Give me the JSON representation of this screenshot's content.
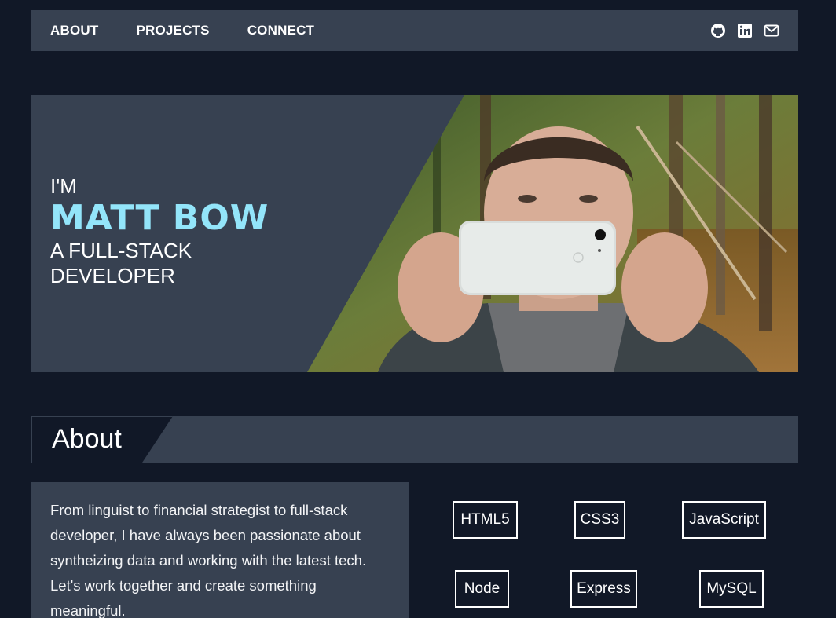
{
  "nav": {
    "links": [
      "ABOUT",
      "PROJECTS",
      "CONNECT"
    ],
    "icons": [
      "github-icon",
      "linkedin-icon",
      "mail-icon"
    ]
  },
  "hero": {
    "intro": "I'M",
    "name": "MATT BOW",
    "role_line1": "A FULL-STACK",
    "role_line2": "DEVELOPER"
  },
  "about": {
    "title": "About",
    "text": "From linguist to financial strategist to full-stack developer, I have always been passionate about syntheizing data and working with the latest tech. Let's work together and create something meaningful."
  },
  "skills": [
    "HTML5",
    "CSS3",
    "JavaScript",
    "Node",
    "Express",
    "MySQL"
  ],
  "colors": {
    "background": "#111827",
    "panel": "#374151",
    "accent": "#93e5fa"
  }
}
